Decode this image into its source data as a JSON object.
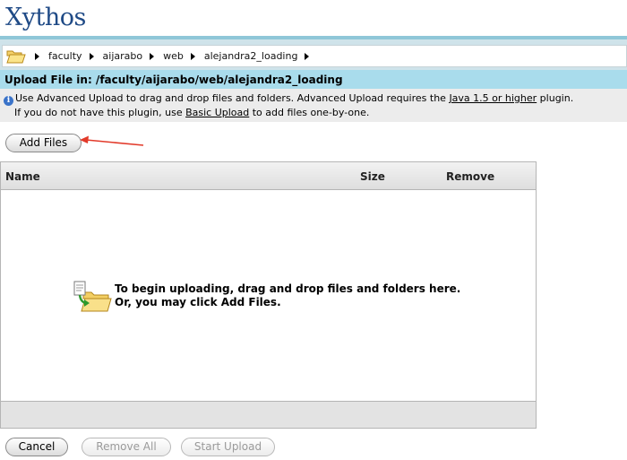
{
  "header": {
    "logo_text": "Xythos"
  },
  "breadcrumb": {
    "icon": "folder-open-icon",
    "items": [
      "faculty",
      "aijarabo",
      "web",
      "alejandra2_loading"
    ]
  },
  "upload": {
    "title": "Upload File in: /faculty/aijarabo/web/alejandra2_loading"
  },
  "info": {
    "line1_text": "Use Advanced Upload to drag and drop files and folders. Advanced Upload requires the ",
    "java_link": "Java 1.5 or higher",
    "line1_suffix": " plugin.",
    "line2_prefix": "If you do not have this plugin, use ",
    "basic_link": "Basic Upload",
    "line2_suffix": " to add files one-by-one."
  },
  "buttons": {
    "add_files": "Add Files",
    "cancel": "Cancel",
    "remove_all": "Remove All",
    "start_upload": "Start Upload"
  },
  "table": {
    "columns": [
      "Name",
      "Size",
      "Remove"
    ]
  },
  "drop_zone": {
    "line1": "To begin uploading, drag and drop files and folders here.",
    "line2": "Or, you may click Add Files."
  },
  "colors": {
    "accent_bar": "#a9dcec",
    "logo": "#1f4a86",
    "annotation_arrow": "#e23a2a"
  }
}
